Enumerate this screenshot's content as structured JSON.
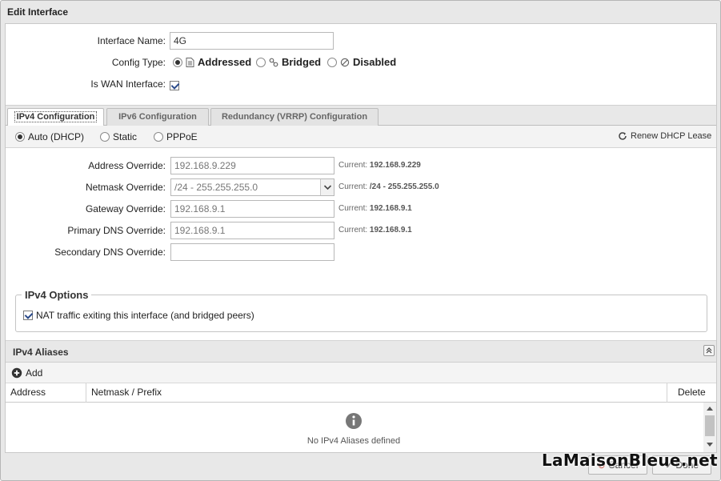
{
  "window": {
    "title": "Edit Interface"
  },
  "form": {
    "interface_name_label": "Interface Name:",
    "interface_name_value": "4G",
    "config_type_label": "Config Type:",
    "config_types": [
      "Addressed",
      "Bridged",
      "Disabled"
    ],
    "config_type_selected": "Addressed",
    "is_wan_label": "Is WAN Interface:",
    "is_wan_checked": true
  },
  "tabs": [
    "IPv4 Configuration",
    "IPv6 Configuration",
    "Redundancy (VRRP) Configuration"
  ],
  "ipv4": {
    "modes": [
      "Auto (DHCP)",
      "Static",
      "PPPoE"
    ],
    "mode_selected": "Auto (DHCP)",
    "renew_label": "Renew DHCP Lease",
    "current_prefix": "Current:",
    "address_override_label": "Address Override:",
    "address_override_value": "192.168.9.229",
    "address_current": "192.168.9.229",
    "netmask_override_label": "Netmask Override:",
    "netmask_override_value": "/24 - 255.255.255.0",
    "netmask_current": "/24 - 255.255.255.0",
    "gateway_override_label": "Gateway Override:",
    "gateway_override_value": "192.168.9.1",
    "gateway_current": "192.168.9.1",
    "primary_dns_label": "Primary DNS Override:",
    "primary_dns_value": "192.168.9.1",
    "primary_dns_current": "192.168.9.1",
    "secondary_dns_label": "Secondary DNS Override:",
    "secondary_dns_value": ""
  },
  "options": {
    "legend": "IPv4 Options",
    "nat_label": "NAT traffic exiting this interface (and bridged peers)",
    "nat_checked": true
  },
  "aliases": {
    "title": "IPv4 Aliases",
    "add_label": "Add",
    "columns": [
      "Address",
      "Netmask / Prefix",
      "Delete"
    ],
    "empty_text": "No IPv4 Aliases defined"
  },
  "footer": {
    "cancel_label": "Cancel",
    "done_label": "Done"
  },
  "watermark": "LaMaisonBleue.net",
  "colors": {
    "accent_check": "#2a4a8a",
    "tab_bg": "#e3e3e3",
    "panel_bg": "#e8e8e8"
  },
  "icons": {
    "addressed": "document-icon",
    "bridged": "link-icon",
    "disabled": "ban-icon",
    "renew": "refresh-icon",
    "add": "plus-circle-icon",
    "info": "info-icon",
    "collapse": "collapse-icon"
  }
}
